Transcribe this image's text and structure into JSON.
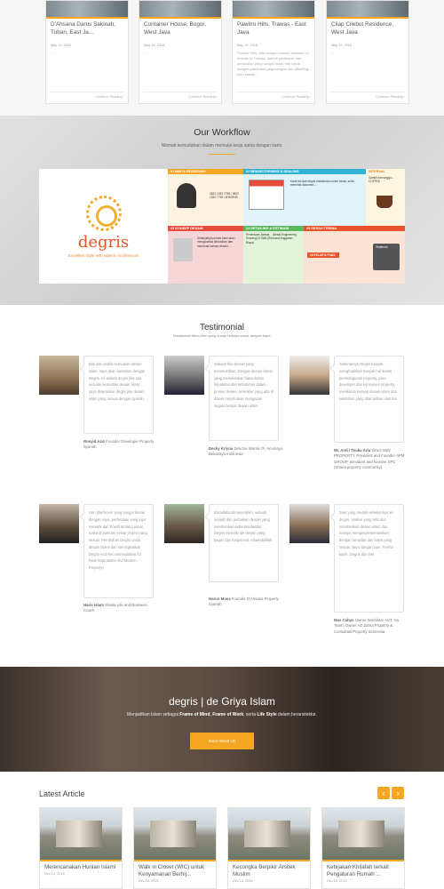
{
  "projects": [
    {
      "title": "D'Ahsana Darus Sakinah, Tuban, East Ja...",
      "date": "May 19, 2016",
      "excerpt": "...",
      "more": "Continue Reading ›"
    },
    {
      "title": "Container House, Bogor, West Java",
      "date": "May 19, 2016",
      "excerpt": "...",
      "more": "Continue Reading ›"
    },
    {
      "title": "Pawitro Hills, Trawas - East Java",
      "date": "May 19, 2016",
      "excerpt": "Pawitro Hills, villa dengan konsep islamiah ini terletak di Trawas, daerah pedesaan dan perbukitan yang sangat indah dan sejuk dengan panorama pegunungan dan dikelilingi oleh sawah...",
      "more": "Continue Reading ›"
    },
    {
      "title": "Cilap Cilebut Residence, West Java",
      "date": "May 19, 2016",
      "excerpt": "...",
      "more": "Continue Reading ›"
    }
  ],
  "workflow": {
    "title": "Our Workflow",
    "subtitle": "Nikmati kemudahan dalam memulai kerja sama dengan kami.",
    "brand": "degris",
    "tagline": "Excellent Style with Islamic Architecture",
    "steps": [
      {
        "head": "#1 MINTA RESERVASI",
        "body": "0822 1332 7798 / 0822 1332 7798 / #DEGRIS"
      },
      {
        "head": "#2 BRAINSTORMING & DEALING",
        "body": "Kami tim dari degris melakukan survei lokasi, serta meminta dokumen..."
      },
      {
        "head": "INTERVAL",
        "body": "Sambil menunggu... COFFEE"
      },
      {
        "head": "#3 KONSEP DESAIN",
        "body": "Selanjutnya proses kami akan menganalisa kebutuhan dan membuat konsep desain..."
      },
      {
        "head": "#4 DETAILING & ESTIMASI",
        "body": "Penentuan Jadwal... (Detail Engineering Drawing) & RAB (Rencana Anggaran Biaya)"
      },
      {
        "head": "#5 SERAH TERIMA",
        "body": "Testimoni"
      },
      {
        "head": "#6 KELAR & PUAS",
        "body": ""
      }
    ]
  },
  "testimonial": {
    "title": "Testimonial",
    "subtitle": "Testimonial klien-klien yang sudah bekerja sama dengan kami.",
    "items": [
      {
        "text": "Bila ada sedikit kemudian desain islam, saya akan sarankan dengan Degris. Ini adalah degris jika ada sesuatu kemudian desain islam, saya disarankan degris jika desain islam yang sesuai dengan syariah.",
        "name": "Rosyid Aziz",
        "role": "Founder Developer Property Syariah"
      },
      {
        "text": "Sebuah fikri desain yang membuktikan. Dengan desain islami yang menekankan batas-batas kepatutan dan kebutuhan dalam proses desain, arsitektur yang ada di dalam rumah akan mengatasi segala bentuk desain islam.",
        "name": "Decky Kriyna",
        "role": "Director Islamic Pi. Amonayo Bekasaya Indonesia"
      },
      {
        "text": "Sebenarnya Degris banyak menghadirkan banyak hal dalam pembangunan property, para developer dan konsumen property, menikmati konsep desain islam dan kelebihan yang ditampilkan oleh tim.",
        "name": "Mr. Ardi / Teuku Arla",
        "role": "Direct AMV PROPERTY, President and Founder APM GROUP, president and founder SPC (Sharia property community)"
      },
      {
        "text": "Hari Ijtial boom yang sangat desak dengan saya, perbedaan yang jujur menarik dan Positif tentang pasar, maka di bantuan setiap project yang sesuai. Perubahan Degris untuk desain islami dan meningkatkan Degris And Recommendation for Real Inspirations And Modern Property!",
        "name": "Haris Islam",
        "role": "Sharia Life and Business Coach"
      },
      {
        "text": "Bismillahirahmanirrahim, sebuah inisiatif dan perbaikan desain yang memberikan kebermanfaatan, Degris memiliki ide desain yang bagus dan fungsional. Alhamdulillah.",
        "name": "Harun Musa",
        "role": "Founder D'Ahsana Property Syariah"
      },
      {
        "text": "Saat yang mudah sebelumnya ke degris, analisa yang teliti dan memberikan desain islam dan mampu mengimplementasikan, dengan tampilan dan biaya yang sesuai, saya sangat puas. Terima kasih, Degris dan tim!",
        "name": "Mas Cahyo",
        "role": "Owner Worldstar AGT, Ivy Team, Owner AZ-Zahra Property & Consultasi Property Indonesia"
      }
    ]
  },
  "hero": {
    "title": "degris | de Griya Islam",
    "subtitle_pre": "Menjadikan Islam sebagai ",
    "b1": "Frame of Mind",
    "mid1": ", ",
    "b2": "Frame of Work",
    "mid2": ", serta ",
    "b3": "Life Style",
    "subtitle_post": " dalam berarsitektur.",
    "button": "More About Us"
  },
  "latest": {
    "title": "Latest Article",
    "prev": "‹",
    "next": "›",
    "articles": [
      {
        "title": "Merencanakan Hunian Islami",
        "date": "Dec 14, 2015"
      },
      {
        "title": "Walk in Closet (WIC) untuk Kenyamanan Berhij...",
        "date": "Dec 14, 2015"
      },
      {
        "title": "Kecongka Berpikir Arsitek Muslim",
        "date": "Dec 14, 2015"
      },
      {
        "title": "Kebijakan Khilafah terkait Pengaturan Rumah ...",
        "date": "Dec 14, 2015"
      }
    ]
  }
}
